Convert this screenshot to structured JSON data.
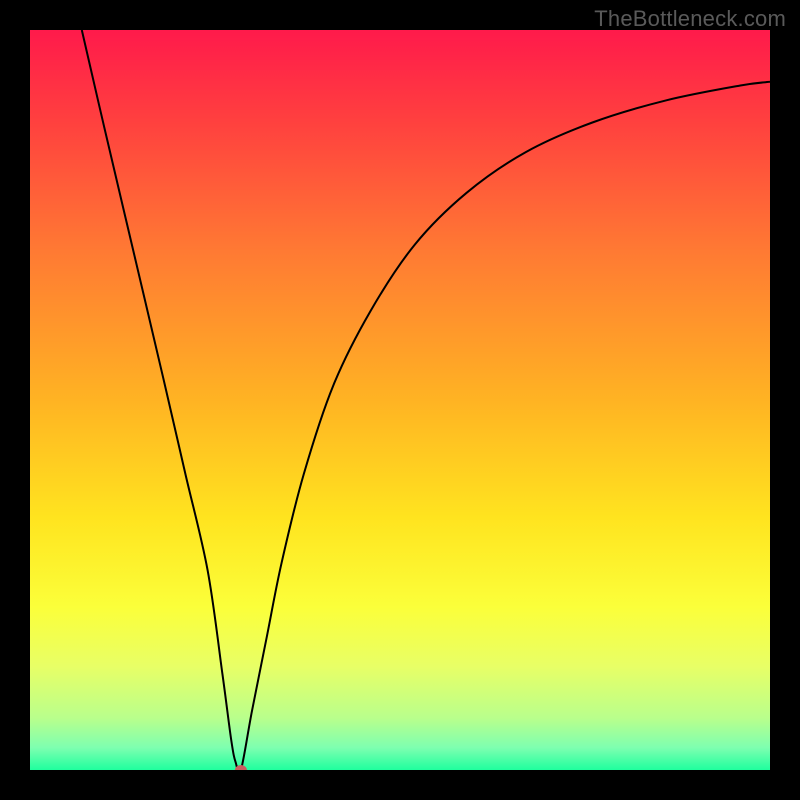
{
  "watermark": "TheBottleneck.com",
  "chart_data": {
    "type": "line",
    "title": "",
    "xlabel": "",
    "ylabel": "",
    "xlim": [
      0,
      100
    ],
    "ylim": [
      0,
      100
    ],
    "background_gradient": {
      "stops": [
        {
          "offset": 0.0,
          "color": "#ff1a4b"
        },
        {
          "offset": 0.12,
          "color": "#ff3f3f"
        },
        {
          "offset": 0.3,
          "color": "#ff7a33"
        },
        {
          "offset": 0.5,
          "color": "#ffb323"
        },
        {
          "offset": 0.66,
          "color": "#ffe41f"
        },
        {
          "offset": 0.78,
          "color": "#fbff3a"
        },
        {
          "offset": 0.86,
          "color": "#e8ff66"
        },
        {
          "offset": 0.93,
          "color": "#b9ff8c"
        },
        {
          "offset": 0.97,
          "color": "#7dffb0"
        },
        {
          "offset": 1.0,
          "color": "#1fff9e"
        }
      ]
    },
    "series": [
      {
        "name": "bottleneck-curve",
        "color": "#000000",
        "stroke_width": 2,
        "x": [
          7,
          10,
          14,
          18,
          21,
          24,
          26,
          27.2,
          27.8,
          28.5,
          30,
          32,
          34,
          37,
          41,
          46,
          52,
          59,
          67,
          76,
          86,
          96,
          100
        ],
        "values": [
          100,
          87,
          70,
          53,
          40,
          27,
          13,
          4,
          1,
          0,
          8,
          18,
          28,
          40,
          52,
          62,
          71,
          78,
          83.5,
          87.5,
          90.5,
          92.5,
          93
        ]
      }
    ],
    "marker": {
      "name": "min-point-marker",
      "x": 28.5,
      "y": 0,
      "rx": 6,
      "ry": 5,
      "color": "#c86060"
    }
  }
}
